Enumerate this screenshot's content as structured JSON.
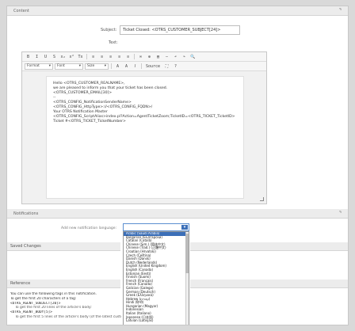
{
  "sections": {
    "content_title": "Content",
    "notifications_title": "Notifications",
    "saved_changes_title": "Saved Changes",
    "reference_title": "Reference",
    "collapse_glyph": "⌝"
  },
  "subject": {
    "label": "Subject:",
    "value": "Ticket Closed: <OTRS_CUSTOMER_SUBJECT[24]>"
  },
  "text_label": "Text:",
  "toolbar": {
    "row1": [
      "B",
      "I",
      "U",
      "S",
      "x₂",
      "x²",
      "Tx",
      "≡",
      "≡",
      "≡",
      "≡",
      "≡",
      "∞",
      "⊕",
      "▤",
      "—",
      "↶",
      "↷",
      "🔍"
    ],
    "format_label": "Format",
    "font_label": "Font",
    "size_label": "Size",
    "row2_tail": [
      "A",
      "A",
      "𝐼",
      "Source",
      "⛶",
      "?"
    ]
  },
  "body_lines": [
    "Hello <OTRS_CUSTOMER_REALNAME>,",
    "",
    "we are pleased to inform you that your ticket has been closed.",
    "",
    "<OTRS_CUSTOMER_EMAIL[30]>",
    "",
    "--",
    "<OTRS_CONFIG_NotificationSenderName>",
    "<OTRS_CONFIG_HttpType>://<OTRS_CONFIG_FQDN>/",
    "Your OTRS Notification Master",
    "<OTRS_CONFIG_ScriptAlias>index.pl?Action=AgentTicketZoom;TicketID=<OTRS_TICKET_TicketID>",
    "",
    "Ticket #<OTRS_TICKET_TicketNumber>"
  ],
  "notifications": {
    "language_label": "Add new notification language:",
    "select_value": ""
  },
  "language_options": [
    "Arabic (Saudi Arabia)",
    "Bulgarian (Български)",
    "Catalan (Català)",
    "Chinese (Sim.) (简体中文)",
    "Chinese (Trad.) (正體中文)",
    "Croatian (Hrvatski)",
    "Czech (Čeština)",
    "Danish (Dansk)",
    "Dutch (Nederlands)",
    "English (United Kingdom)",
    "English (Canada)",
    "Estonian (Eesti)",
    "Finnish (Suomi)",
    "French (Français)",
    "French (Canada)",
    "Galician (Galego)",
    "German (Deutsch)",
    "Greek (Ελληνικά)",
    "Hebrew (עברית)",
    "Hindi (हिन्दी)",
    "Hungarian (Magyar)",
    "Indonesian",
    "Italian (Italiano)",
    "Japanese (日本語)",
    "Latvian (Latvijas)"
  ],
  "reference": {
    "intro_1": "You can use the following tags in this notification.",
    "intro_2": "To get the first 20 characters of a tag:",
    "items": [
      "<OTRS_AGENT_SUBJECT[20]>",
      "To get the first 20 lines of the article's body:",
      "<OTRS_AGENT_BODY[5]>",
      "To get the first 5 lines of the article's body (of the latest customer article):"
    ]
  }
}
